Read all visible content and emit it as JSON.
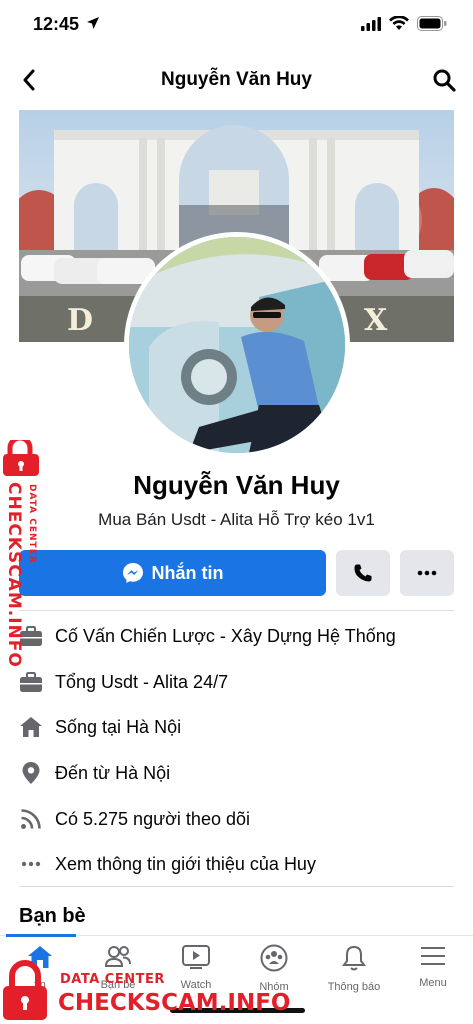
{
  "status": {
    "time": "12:45"
  },
  "nav": {
    "title": "Nguyễn Văn Huy"
  },
  "cover": {
    "banner_text_left": "D",
    "banner_text_right": "X"
  },
  "profile": {
    "name": "Nguyễn Văn Huy",
    "bio": "Mua Bán Usdt - Alita Hỗ Trợ kéo 1v1"
  },
  "actions": {
    "message_label": "Nhắn tin"
  },
  "info": [
    {
      "icon": "briefcase-icon",
      "text": "Cố Vấn Chiến Lược - Xây Dựng Hệ Thống"
    },
    {
      "icon": "briefcase-icon",
      "text": "Tổng Usdt - Alita 24/7"
    },
    {
      "icon": "home-icon",
      "prefix": "Sống tại ",
      "strong": "Hà Nội"
    },
    {
      "icon": "location-icon",
      "prefix": "Đến từ ",
      "strong": "Hà Nội"
    },
    {
      "icon": "followers-icon",
      "text": "Có 5.275 người theo dõi"
    },
    {
      "icon": "more-dots-icon",
      "text": "Xem thông tin giới thiệu của Huy"
    }
  ],
  "friends": {
    "title": "Bạn bè"
  },
  "tabs": [
    {
      "label": "tin",
      "icon": "home-icon",
      "active": true
    },
    {
      "label": "Bạn bè",
      "icon": "friends-icon"
    },
    {
      "label": "Watch",
      "icon": "watch-icon"
    },
    {
      "label": "Nhóm",
      "icon": "groups-icon"
    },
    {
      "label": "Thông báo",
      "icon": "bell-icon"
    },
    {
      "label": "Menu",
      "icon": "menu-icon"
    }
  ],
  "watermark": {
    "side_small": "DATA CENTER",
    "side_big": "CHECKSCAM.INFO",
    "bottom_small": "DATA CENTER",
    "bottom_big": "CHECKSCAM.INFO",
    "color": "#e3202a"
  }
}
